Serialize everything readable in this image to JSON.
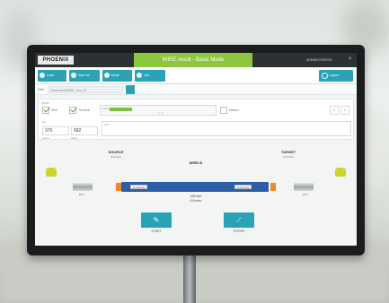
{
  "window": {
    "brand": "PHOENIX",
    "title": "WIRE result - Basic Mode",
    "user": "ADMINISTRATOR",
    "close_glyph": "×"
  },
  "toolbar": {
    "buttons": [
      {
        "label": "Load",
        "icon": "folder-icon"
      },
      {
        "label": "Save as",
        "icon": "save-icon"
      },
      {
        "label": "Mode",
        "icon": "mode-icon"
      },
      {
        "label": "Job",
        "icon": "job-icon"
      }
    ],
    "right_button": {
      "label": "Logout",
      "icon": "power-icon"
    }
  },
  "path": {
    "label": "Path",
    "value": "\\Data\\clipx\\WIRE_Test_01",
    "button_icon": "browse-icon"
  },
  "mode_panel": {
    "label": "Mode",
    "options": [
      {
        "label": "Wire",
        "checked": true
      },
      {
        "label": "Terminal",
        "checked": true
      },
      {
        "label": "Marker",
        "checked": false
      }
    ],
    "progress": {
      "label": "Status",
      "fraction": 0.2,
      "text": "1 / 5"
    },
    "nav_prev": "‹",
    "nav_next": "›",
    "qty_label": "Qty",
    "qty_value": "370",
    "qty_sublabel": "Pieces",
    "second_value": "582",
    "second_sublabel": "Batch",
    "notes_label": "Note"
  },
  "diagram": {
    "source_title": "SOURCE",
    "source_sub": "0.5 mm²",
    "target_title": "TARGET",
    "target_sub": "0.5 mm²",
    "wire_title": "WIRE-B",
    "left_tag": "AI 0.5-8 OG",
    "right_tag": "AI 0.5-8 OG",
    "left_strip": "8mm",
    "right_strip": "8mm",
    "cross_section_line1": "100 mm",
    "cross_section_line2": "0.5 mm²",
    "colors": {
      "wire": "#2d5fa8",
      "sleeve": "#f08a24",
      "plug": "#c8d62d"
    }
  },
  "actions": {
    "start": {
      "label": "START",
      "icon": "start-icon"
    },
    "stop": {
      "label": "STRIPE",
      "icon": "stripe-icon"
    }
  },
  "colors": {
    "accent": "#2aa3b7",
    "title_green": "#8dc63f",
    "titlebar": "#2c3136"
  }
}
